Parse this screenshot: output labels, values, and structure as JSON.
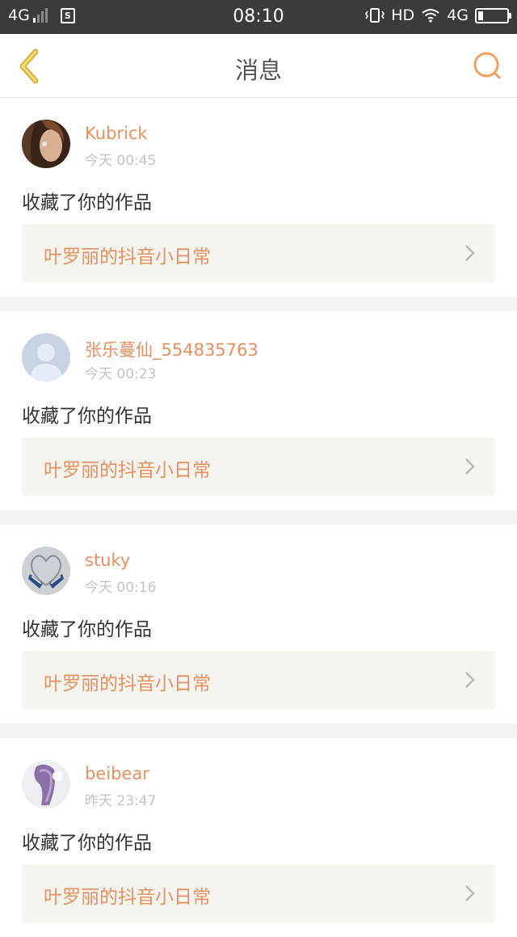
{
  "status_bar": {
    "network": "4G",
    "time": "08:10",
    "hd": "HD",
    "network_right": "4G",
    "sim_label": "S"
  },
  "nav": {
    "title": "消息",
    "accent_color": "#f0a060",
    "back_icon": "chevron-left-icon",
    "search_icon": "search-icon"
  },
  "messages": [
    {
      "name": "Kubrick",
      "time": "今天 00:45",
      "action": "收藏了你的作品",
      "work_title": "叶罗丽的抖音小日常",
      "avatar_icon": "avatar-photo-woman"
    },
    {
      "name": "张乐蔓仙_554835763",
      "time": "今天 00:23",
      "action": "收藏了你的作品",
      "work_title": "叶罗丽的抖音小日常",
      "avatar_icon": "avatar-default-person"
    },
    {
      "name": "stuky",
      "time": "今天 00:16",
      "action": "收藏了你的作品",
      "work_title": "叶罗丽的抖音小日常",
      "avatar_icon": "avatar-photo-shoes"
    },
    {
      "name": "beibear",
      "time": "昨天 23:47",
      "action": "收藏了你的作品",
      "work_title": "叶罗丽的抖音小日常",
      "avatar_icon": "avatar-photo-purple"
    }
  ]
}
